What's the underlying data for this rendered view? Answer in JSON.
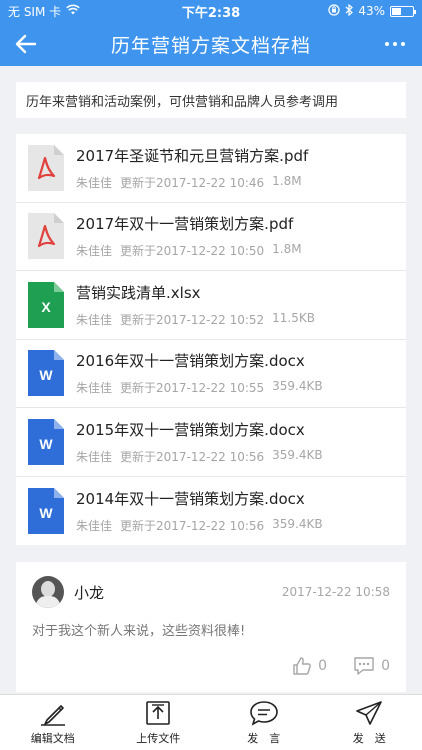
{
  "status_bar": {
    "carrier": "无 SIM 卡",
    "time": "下午2:38",
    "battery": "43%",
    "battery_level": 0.43
  },
  "nav": {
    "title": "历年营销方案文档存档"
  },
  "description": "历年来营销和活动案例，可供营销和品牌人员参考调用",
  "files": [
    {
      "name": "2017年圣诞节和元旦营销方案.pdf",
      "author": "朱佳佳",
      "updated": "更新于2017-12-22 10:46",
      "size": "1.8M",
      "type": "pdf",
      "icon": "pdf-file-icon"
    },
    {
      "name": "2017年双十一营销策划方案.pdf",
      "author": "朱佳佳",
      "updated": "更新于2017-12-22 10:50",
      "size": "1.8M",
      "type": "pdf",
      "icon": "pdf-file-icon"
    },
    {
      "name": "营销实践清单.xlsx",
      "author": "朱佳佳",
      "updated": "更新于2017-12-22 10:52",
      "size": "11.5KB",
      "type": "xlsx",
      "icon": "excel-file-icon",
      "letter": "X"
    },
    {
      "name": "2016年双十一营销策划方案.docx",
      "author": "朱佳佳",
      "updated": "更新于2017-12-22 10:55",
      "size": "359.4KB",
      "type": "docx",
      "icon": "word-file-icon",
      "letter": "W"
    },
    {
      "name": "2015年双十一营销策划方案.docx",
      "author": "朱佳佳",
      "updated": "更新于2017-12-22 10:56",
      "size": "359.4KB",
      "type": "docx",
      "icon": "word-file-icon",
      "letter": "W"
    },
    {
      "name": "2014年双十一营销策划方案.docx",
      "author": "朱佳佳",
      "updated": "更新于2017-12-22 10:56",
      "size": "359.4KB",
      "type": "docx",
      "icon": "word-file-icon",
      "letter": "W"
    }
  ],
  "comment": {
    "user": "小龙",
    "time": "2017-12-22 10:58",
    "text": "对于我这个新人来说，这些资料很棒!",
    "likes": "0",
    "replies": "0"
  },
  "tabs": [
    {
      "label": "编辑文档",
      "icon": "pencil-icon"
    },
    {
      "label": "上传文件",
      "icon": "upload-icon"
    },
    {
      "label": "发　言",
      "icon": "chat-bubble-icon"
    },
    {
      "label": "发　送",
      "icon": "send-plane-icon"
    }
  ],
  "colors": {
    "accent": "#3f95ee",
    "pdf": "#e0413d",
    "excel": "#1f9f52",
    "word": "#2f6ed8",
    "muted": "#a6a6a6"
  }
}
